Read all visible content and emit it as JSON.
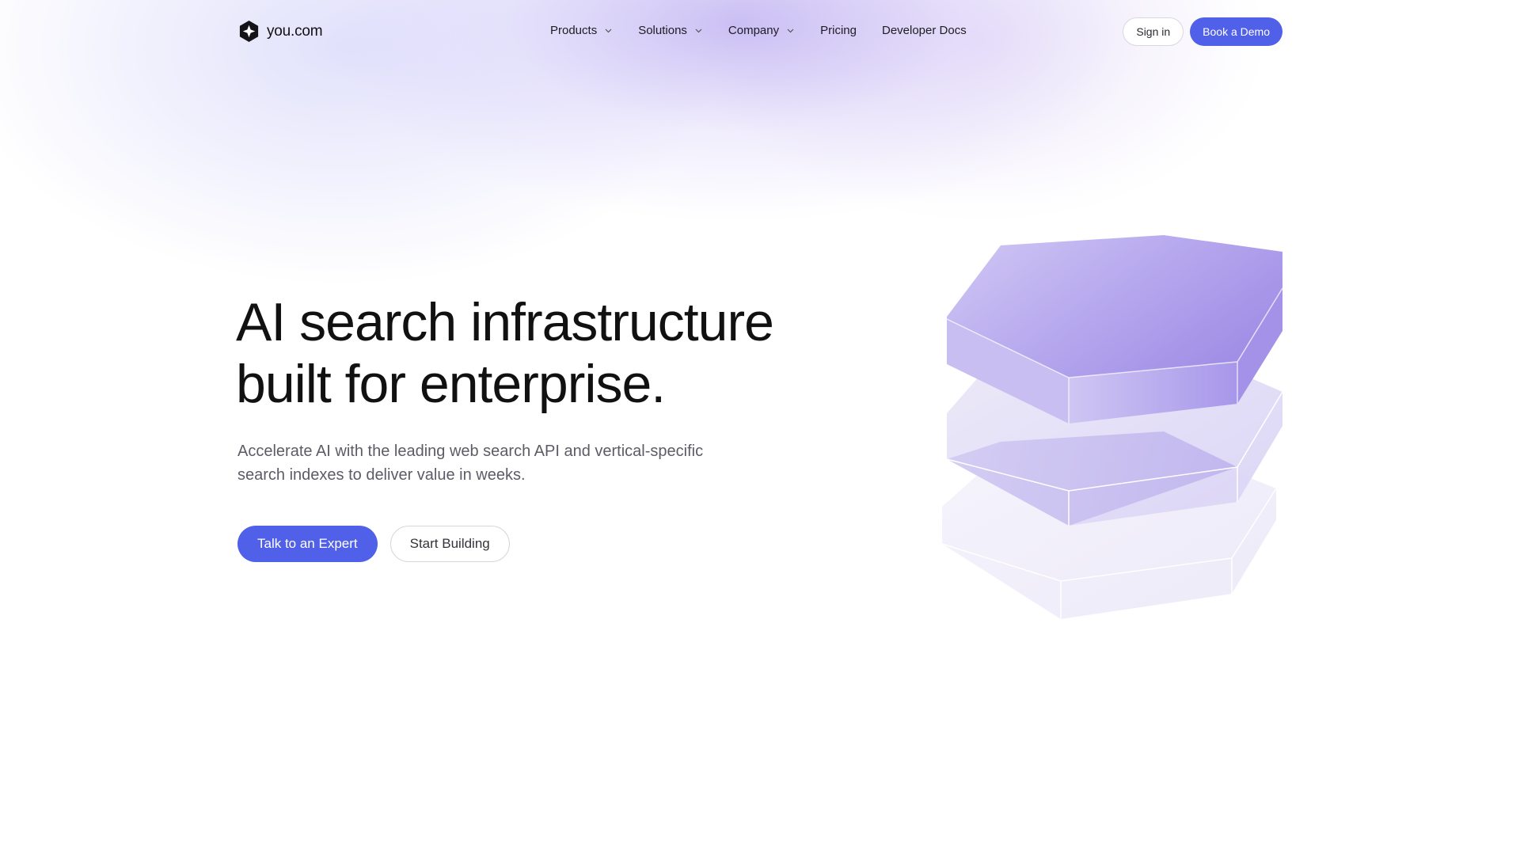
{
  "brand": {
    "name": "you.com",
    "logo_icon": "you-com-logo-icon",
    "accent_color": "#5060e8"
  },
  "nav": {
    "items": [
      {
        "label": "Products",
        "has_dropdown": true
      },
      {
        "label": "Solutions",
        "has_dropdown": true
      },
      {
        "label": "Company",
        "has_dropdown": true
      },
      {
        "label": "Pricing",
        "has_dropdown": false
      },
      {
        "label": "Developer Docs",
        "has_dropdown": false
      }
    ],
    "sign_in_label": "Sign in",
    "book_demo_label": "Book a Demo"
  },
  "hero": {
    "title_line1": "AI search infrastructure",
    "title_line2": "built for enterprise.",
    "subtitle_line1": "Accelerate AI with the leading web search API and vertical-specific",
    "subtitle_line2": "search indexes to deliver value in weeks.",
    "primary_cta": "Talk to an Expert",
    "secondary_cta": "Start Building"
  },
  "illustration": {
    "icon": "stacked-hexagons-illustration",
    "colors": [
      "#a898ec",
      "#c2b6f0",
      "#e6e2f8"
    ]
  }
}
